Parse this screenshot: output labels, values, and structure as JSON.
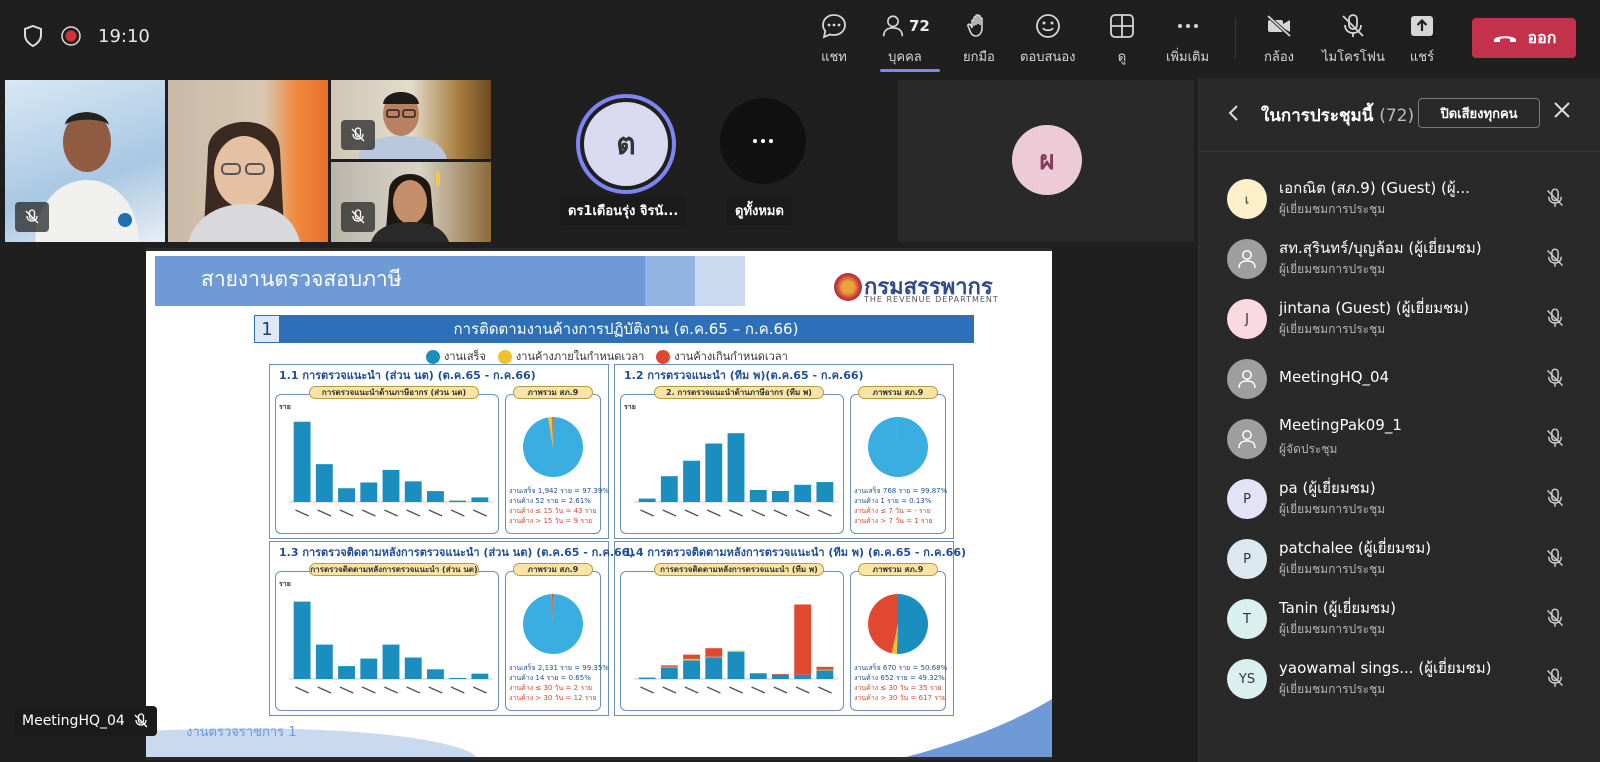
{
  "topbar": {
    "time": "19:10",
    "chat_label": "แชท",
    "people_label": "บุคคล",
    "people_count": "72",
    "raise_label": "ยกมือ",
    "react_label": "ตอบสนอง",
    "view_label": "ดู",
    "more_label": "เพิ่มเติม",
    "camera_label": "กล้อง",
    "mic_label": "ไมโครโฟน",
    "share_label": "แชร์",
    "leave_label": "ออก"
  },
  "stage": {
    "tile_initial": "ต",
    "tile_name": "ดร1เดือนรุ่ง จิรนั...",
    "view_all_label": "ดูทั้งหมด",
    "big_avatar_initial": "ผ",
    "presenter_name": "MeetingHQ_04"
  },
  "slide": {
    "header_title": "สายงานตรวจสอบภาษี",
    "logo_text": "กรมสรรพากร",
    "logo_sub": "THE REVENUE DEPARTMENT",
    "section_number": "1",
    "section_title": "การติดตามงานค้างการปฏิบัติงาน (ต.ค.65 – ก.ค.66)",
    "legend": [
      "งานเสร็จ",
      "งานค้างภายในกำหนดเวลา",
      "งานค้างเกินกำหนดเวลา"
    ],
    "legend_colors": [
      "#1a8fbf",
      "#f2c12e",
      "#e0492f"
    ],
    "footer": "งานตรวจราชการ 1",
    "quadrants": [
      {
        "title": "1.1 การตรวจแนะนำ (ส่วน นต) (ต.ค.65 - ก.ค.66)",
        "chart_title": "การตรวจแนะนำด้านภาษีอากร (ส่วน นต)",
        "pie_title": "ภาพรวม สภ.9",
        "y_axis_label": "ราย",
        "stats": [
          "งานเสร็จ 1,942 ราย = 97.39%",
          "งานค้าง 52 ราย = 2.61%",
          "งานค้าง ≤ 15 วัน = 43 ราย",
          "งานค้าง > 15 วัน = 9 ราย"
        ]
      },
      {
        "title": "1.2 การตรวจแนะนำ (ทีม พ)(ต.ค.65 - ก.ค.66)",
        "chart_title": "2. การตรวจแนะนำด้านภาษีอากร (ทีม พ)",
        "pie_title": "ภาพรวม สภ.9",
        "y_axis_label": "ราย",
        "stats": [
          "งานเสร็จ 768 ราย = 99.87%",
          "งานค้าง 1 ราย = 0.13%",
          "งานค้าง ≤ 7 วัน = - ราย",
          "งานค้าง > 7 วัน = 1 ราย"
        ]
      },
      {
        "title": "1.3 การตรวจติดตามหลังการตรวจแนะนำ (ส่วน นต) (ต.ค.65 - ก.ค.66)",
        "chart_title": "การตรวจติดตามหลังการตรวจแนะนำ (ส่วน นต)",
        "pie_title": "ภาพรวม สภ.9",
        "y_axis_label": "ราย",
        "stats": [
          "งานเสร็จ 2,131 ราย = 99.35%",
          "งานค้าง 14 ราย = 0.65%",
          "งานค้าง ≤ 30 วัน = 2 ราย",
          "งานค้าง > 30 วัน = 12 ราย"
        ]
      },
      {
        "title": "1.4 การตรวจติดตามหลังการตรวจแนะนำ (ทีม พ) (ต.ค.65 - ก.ค.66)",
        "chart_title": "การตรวจติดตามหลังการตรวจแนะนำ (ทีม พ)",
        "pie_title": "ภาพรวม สภ.9",
        "y_axis_label": "",
        "stats": [
          "งานเสร็จ 670 ราย = 50.68%",
          "งานค้าง 652 ราย = 49.32%",
          "งานค้าง ≤ 30 วัน = 35 ราย",
          "งานค้าง > 30 วัน = 617 ราย"
        ]
      }
    ]
  },
  "chart_data": [
    {
      "type": "bar",
      "series": [
        {
          "values": [
            700,
            330,
            120,
            170,
            280,
            180,
            95,
            12,
            40
          ]
        }
      ],
      "ylim": [
        0,
        750
      ]
    },
    {
      "type": "bar",
      "series": [
        {
          "values": [
            10,
            75,
            120,
            170,
            200,
            35,
            32,
            50,
            58
          ]
        }
      ],
      "ylim": [
        0,
        250
      ]
    },
    {
      "type": "bar",
      "series": [
        {
          "values": [
            720,
            320,
            120,
            190,
            320,
            200,
            90,
            10,
            50
          ]
        }
      ],
      "ylim": [
        0,
        800
      ]
    },
    {
      "type": "bar",
      "series": [
        {
          "name": "งานเสร็จ",
          "values": [
            10,
            80,
            130,
            150,
            190,
            40,
            30,
            30,
            60
          ]
        },
        {
          "name": "งานค้างภายในกำหนดเวลา",
          "values": [
            0,
            5,
            10,
            5,
            8,
            0,
            0,
            0,
            5
          ]
        },
        {
          "name": "งานค้างเกินกำหนดเวลา",
          "values": [
            0,
            10,
            30,
            60,
            0,
            0,
            5,
            490,
            20
          ]
        }
      ],
      "ylim": [
        0,
        600
      ]
    }
  ],
  "panel": {
    "title": "ในการประชุมนี้",
    "count": "(72)",
    "mute_all_label": "ปิดเสียงทุกคน",
    "participants": [
      {
        "name": "เอกณิต (สภ.9) (Guest) (ผู้...",
        "role": "ผู้เยี่ยมชมการประชุม",
        "initial": "เ",
        "color": "#fbf0c8"
      },
      {
        "name": "สท.สุรินทร์/บุญล้อม (ผู้เยี่ยมชม)",
        "role": "ผู้เยี่ยมชมการประชุม",
        "initial": "",
        "color": "#9e9e9e"
      },
      {
        "name": "jintana (Guest) (ผู้เยี่ยมชม)",
        "role": "ผู้เยี่ยมชมการประชุม",
        "initial": "J",
        "color": "#f8d9e2"
      },
      {
        "name": "MeetingHQ_04",
        "role": "",
        "initial": "",
        "color": "#9e9e9e"
      },
      {
        "name": "MeetingPak09_1",
        "role": "ผู้จัดประชุม",
        "initial": "",
        "color": "#9e9e9e"
      },
      {
        "name": "pa (ผู้เยี่ยมชม)",
        "role": "ผู้เยี่ยมชมการประชุม",
        "initial": "P",
        "color": "#e3e3f7"
      },
      {
        "name": "patchalee (ผู้เยี่ยมชม)",
        "role": "ผู้เยี่ยมชมการประชุม",
        "initial": "P",
        "color": "#dbe8ef"
      },
      {
        "name": "Tanin (ผู้เยี่ยมชม)",
        "role": "ผู้เยี่ยมชมการประชุม",
        "initial": "T",
        "color": "#d9f0ee"
      },
      {
        "name": "yaowamal sings...  (ผู้เยี่ยมชม)",
        "role": "ผู้เยี่ยมชมการประชุม",
        "initial": "YS",
        "color": "#d9f0ee"
      }
    ]
  }
}
